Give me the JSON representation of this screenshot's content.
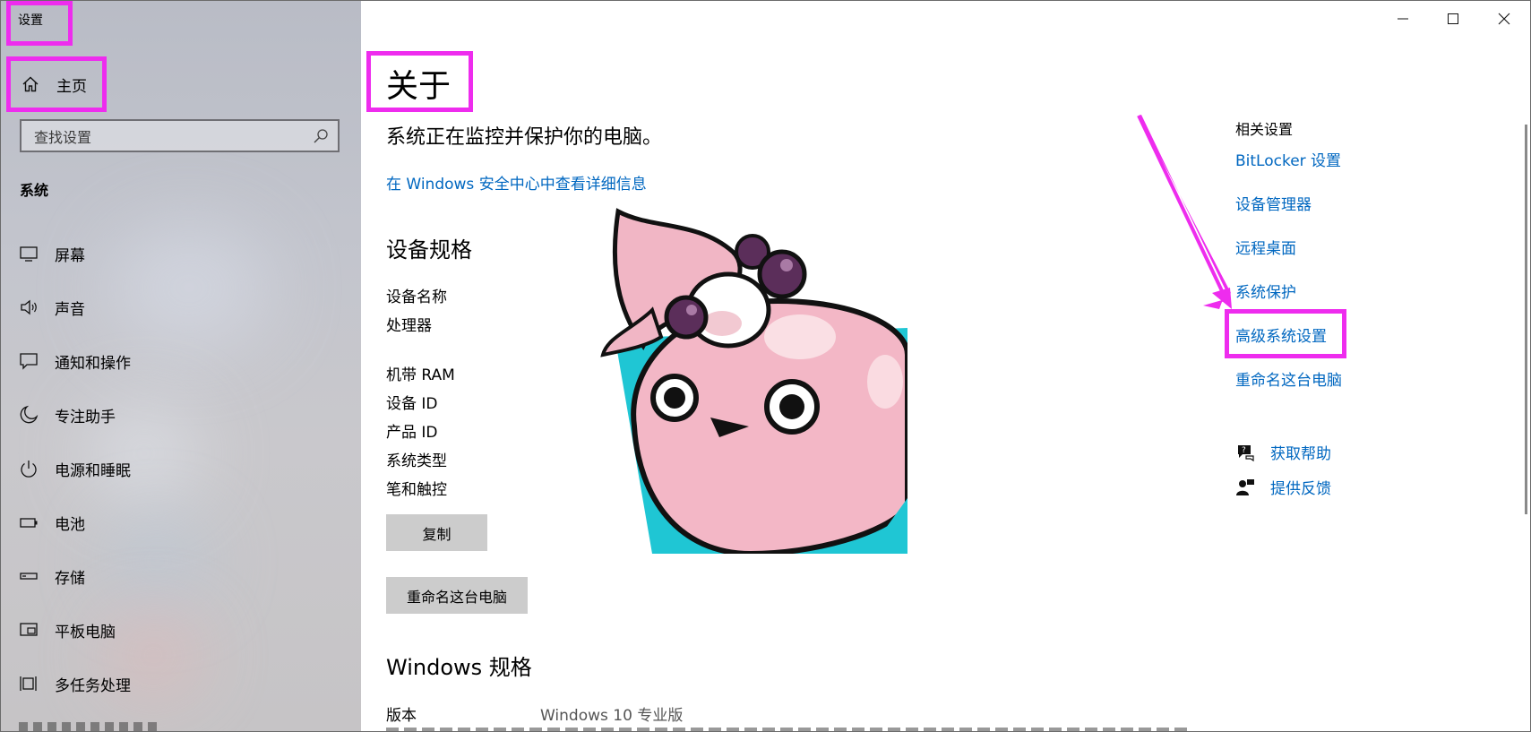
{
  "window": {
    "app_title": "设置",
    "controls": {
      "minimize": "minimize-icon",
      "maximize": "maximize-icon",
      "close": "close-icon"
    }
  },
  "sidebar": {
    "home_label": "主页",
    "search_placeholder": "查找设置",
    "section_title": "系统",
    "items": [
      {
        "label": "屏幕",
        "icon": "monitor-icon"
      },
      {
        "label": "声音",
        "icon": "speaker-icon"
      },
      {
        "label": "通知和操作",
        "icon": "message-icon"
      },
      {
        "label": "专注助手",
        "icon": "moon-icon"
      },
      {
        "label": "电源和睡眠",
        "icon": "power-icon"
      },
      {
        "label": "电池",
        "icon": "battery-icon"
      },
      {
        "label": "存储",
        "icon": "storage-icon"
      },
      {
        "label": "平板电脑",
        "icon": "tablet-icon"
      },
      {
        "label": "多任务处理",
        "icon": "multitask-icon"
      }
    ]
  },
  "main": {
    "title": "关于",
    "monitor_text": "系统正在监控并保护你的电脑。",
    "security_link": "在 Windows 安全中心中查看详细信息",
    "device_specs": {
      "heading": "设备规格",
      "labels": [
        "设备名称",
        "处理器",
        "机带 RAM",
        "设备 ID",
        "产品 ID",
        "系统类型",
        "笔和触控"
      ],
      "copy_button": "复制"
    },
    "rename_button": "重命名这台电脑",
    "windows_specs": {
      "heading": "Windows 规格",
      "edition_label": "版本",
      "edition_value": "Windows 10 专业版"
    },
    "related": {
      "heading": "相关设置",
      "links": [
        "BitLocker 设置",
        "设备管理器",
        "远程桌面",
        "系统保护",
        "高级系统设置",
        "重命名这台电脑"
      ]
    },
    "help": [
      {
        "label": "获取帮助",
        "icon": "help-chat-icon"
      },
      {
        "label": "提供反馈",
        "icon": "feedback-icon"
      }
    ]
  },
  "colors": {
    "accent_link": "#0067c0",
    "annotation": "#ee2cee",
    "button_bg": "#cccccc"
  }
}
